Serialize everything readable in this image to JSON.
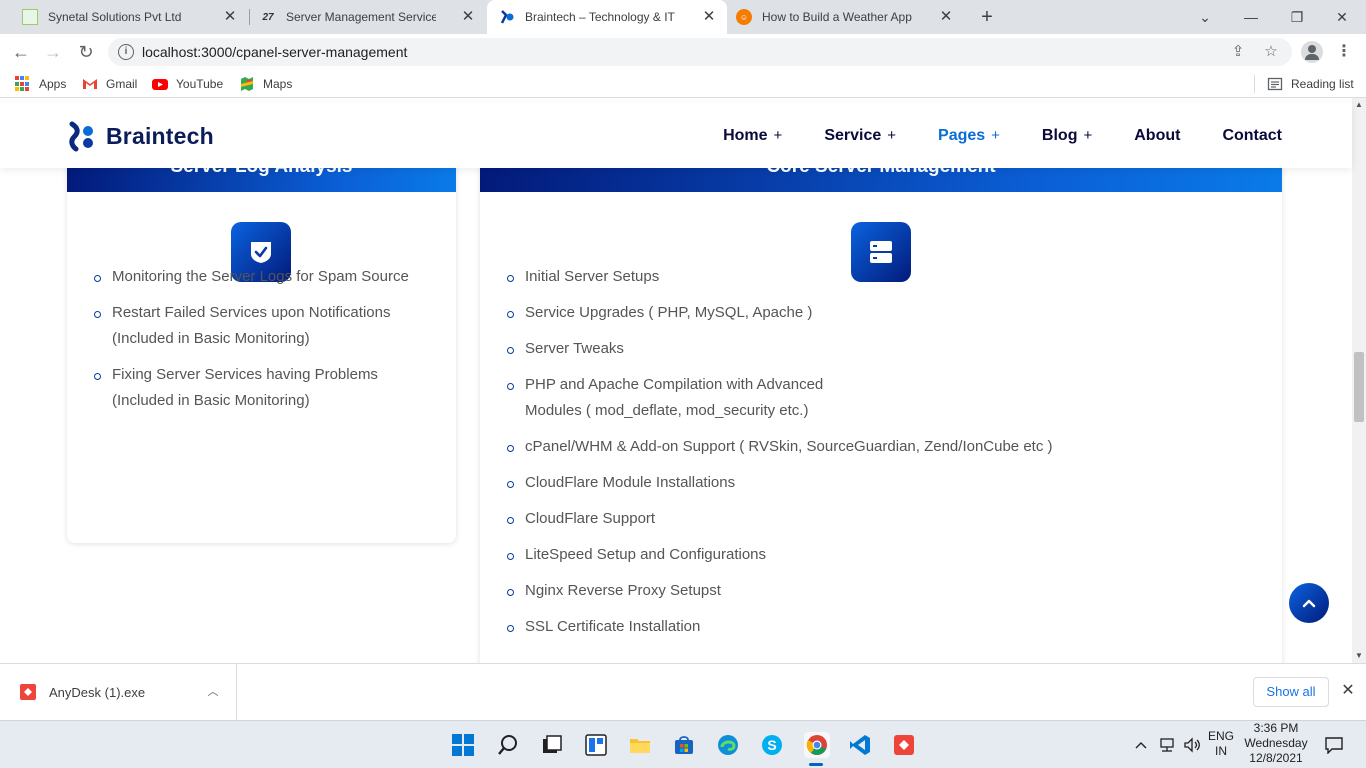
{
  "browser": {
    "tabs": [
      {
        "title": "Synetal Solutions Pvt Ltd",
        "close": "✕"
      },
      {
        "title": "Server Management Services | Se",
        "close": "✕"
      },
      {
        "title": "Braintech – Technology & IT Solu",
        "close": "✕"
      },
      {
        "title": "How to Build a Weather App Usin",
        "close": "✕"
      }
    ],
    "new_tab": "+",
    "url": "localhost:3000/cpanel-server-management",
    "bookmarks": [
      {
        "label": "Apps"
      },
      {
        "label": "Gmail"
      },
      {
        "label": "YouTube"
      },
      {
        "label": "Maps"
      }
    ],
    "reading_list": "Reading list"
  },
  "site": {
    "logo_text": "Braintech",
    "nav": [
      {
        "label": "Home",
        "plus": "+"
      },
      {
        "label": "Service",
        "plus": "+"
      },
      {
        "label": "Pages",
        "plus": "+"
      },
      {
        "label": "Blog",
        "plus": "+"
      },
      {
        "label": "About"
      },
      {
        "label": "Contact"
      }
    ],
    "accent_color": "#0a6cd8",
    "brand_dark": "#031a7a"
  },
  "cards": {
    "left": {
      "title": "Server Log Analysis",
      "icon": "shield-check-icon",
      "items": [
        "Monitoring the Server Logs for Spam Source",
        "Restart Failed Services upon Notifications (Included in Basic Monitoring)",
        "Fixing Server Services having Problems (Included in Basic Monitoring)"
      ]
    },
    "right": {
      "title": "Core Server Management",
      "icon": "server-icon",
      "items": [
        "Initial Server Setups",
        "Service Upgrades ( PHP, MySQL, Apache )",
        "Server Tweaks",
        "PHP and Apache Compilation with Advanced Modules ( mod_deflate, mod_security etc.)",
        "cPanel/WHM & Add-on Support ( RVSkin, SourceGuardian, Zend/IonCube etc )",
        "CloudFlare Module Installations",
        "CloudFlare Support",
        "LiteSpeed Setup and Configurations",
        "Nginx Reverse Proxy Setupst",
        "SSL Certificate Installation"
      ]
    }
  },
  "downloads": {
    "file": "AnyDesk (1).exe",
    "show_all": "Show all"
  },
  "taskbar": {
    "lang_line1": "ENG",
    "lang_line2": "IN",
    "time": "3:36 PM",
    "day": "Wednesday",
    "date": "12/8/2021"
  }
}
